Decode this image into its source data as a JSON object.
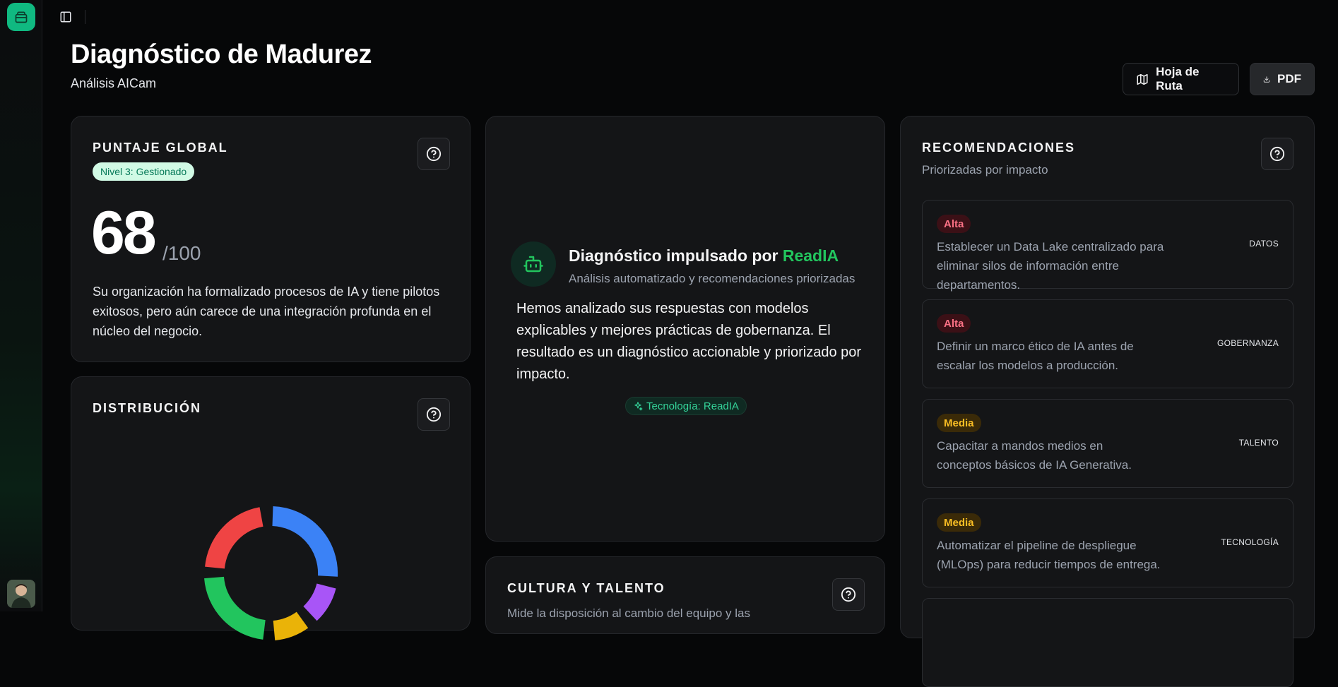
{
  "page": {
    "title": "Diagnóstico de Madurez",
    "subtitle": "Análisis AICam"
  },
  "toolbar": {
    "roadmap_label": "Hoja de Ruta",
    "pdf_label": "PDF"
  },
  "score_card": {
    "title": "PUNTAJE GLOBAL",
    "level_badge": "Nivel 3: Gestionado",
    "score": "68",
    "score_max": "/100",
    "score_value": 68,
    "description": "Su organización ha formalizado procesos de IA y tiene pilotos exitosos, pero aún carece de una integración profunda en el núcleo del negocio."
  },
  "distribution_card": {
    "title": "DISTRIBUCIÓN",
    "segment_colors": [
      "#3b82f6",
      "#a855f7",
      "#eab308",
      "#22c55e",
      "#ef4444"
    ]
  },
  "ai_card": {
    "title_prefix": "Diagnóstico impulsado por ",
    "title_brand": "ReadIA",
    "subtitle": "Análisis automatizado y recomendaciones priorizadas",
    "body": "Hemos analizado sus respuestas con modelos explicables y mejores prácticas de gobernanza. El resultado es un diagnóstico accionable y priorizado por impacto.",
    "tech_chip": "Tecnología: ReadIA"
  },
  "culture_card": {
    "title": "CULTURA Y TALENTO",
    "description": "Mide la disposición al cambio del equipo y las"
  },
  "recommendations": {
    "title": "RECOMENDACIONES",
    "subtitle": "Priorizadas por impacto",
    "items": [
      {
        "priority": "Alta",
        "text": "Establecer un Data Lake centralizado para eliminar silos de información entre departamentos.",
        "category": "DATOS"
      },
      {
        "priority": "Alta",
        "text": "Definir un marco ético de IA antes de escalar los modelos a producción.",
        "category": "GOBERNANZA"
      },
      {
        "priority": "Media",
        "text": "Capacitar a mandos medios en conceptos básicos de IA Generativa.",
        "category": "TALENTO"
      },
      {
        "priority": "Media",
        "text": "Automatizar el pipeline de despliegue (MLOps) para reducir tiempos de entrega.",
        "category": "TECNOLOGÍA"
      }
    ]
  },
  "colors": {
    "accent": "#10b981",
    "brand_text": "#22c55e",
    "priority_high": "#fb7185",
    "priority_medium": "#fbbf24"
  },
  "icons": {
    "logo": "app-logo-icon",
    "sidebar_toggle": "sidebar-toggle-icon",
    "roadmap": "map-icon",
    "pdf": "download-icon",
    "help": "help-circle-icon",
    "ai": "bot-icon",
    "tech_chip": "sparkles-icon"
  }
}
